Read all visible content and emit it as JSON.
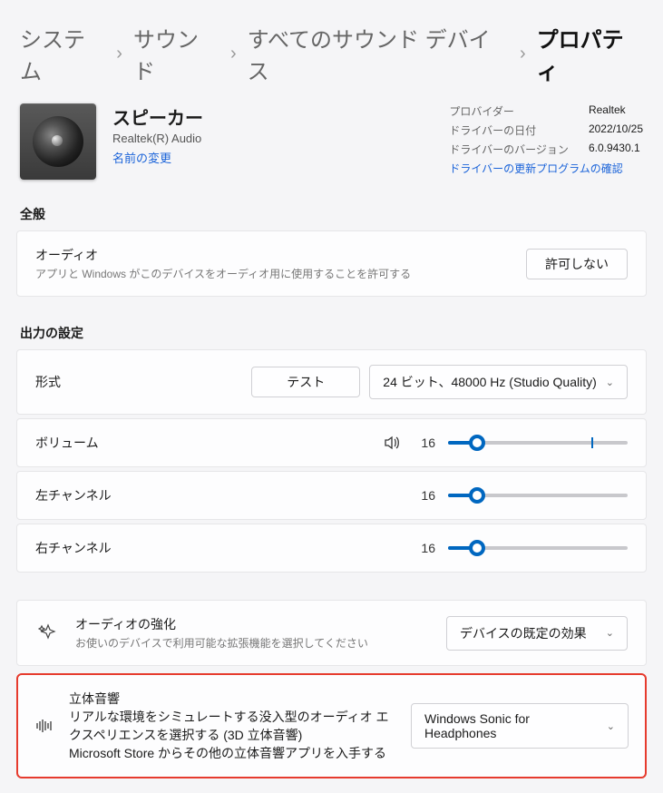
{
  "breadcrumb": {
    "system": "システム",
    "sound": "サウンド",
    "all_devices": "すべてのサウンド デバイス",
    "properties": "プロパティ"
  },
  "device": {
    "name": "スピーカー",
    "subtitle": "Realtek(R) Audio",
    "rename": "名前の変更"
  },
  "info": {
    "provider_label": "プロバイダー",
    "provider_value": "Realtek",
    "driver_date_label": "ドライバーの日付",
    "driver_date_value": "2022/10/25",
    "driver_version_label": "ドライバーのバージョン",
    "driver_version_value": "6.0.9430.1",
    "update_link": "ドライバーの更新プログラムの確認"
  },
  "general": {
    "heading": "全般",
    "audio_title": "オーディオ",
    "audio_desc": "アプリと Windows がこのデバイスをオーディオ用に使用することを許可する",
    "button": "許可しない"
  },
  "output": {
    "heading": "出力の設定",
    "format_label": "形式",
    "test_button": "テスト",
    "format_value": "24 ビット、48000 Hz (Studio Quality)",
    "volume_label": "ボリューム",
    "volume_value": "16",
    "left_label": "左チャンネル",
    "left_value": "16",
    "right_label": "右チャンネル",
    "right_value": "16"
  },
  "enhance": {
    "title": "オーディオの強化",
    "desc": "お使いのデバイスで利用可能な拡張機能を選択してください",
    "dropdown": "デバイスの既定の効果"
  },
  "spatial": {
    "title": "立体音響",
    "desc": "リアルな環境をシミュレートする没入型のオーディオ エクスペリエンスを選択する (3D 立体音響)",
    "link": "Microsoft Store からその他の立体音響アプリを入手する",
    "dropdown": "Windows Sonic for Headphones"
  },
  "slider": {
    "pct": 16,
    "tick_pct": 80
  }
}
